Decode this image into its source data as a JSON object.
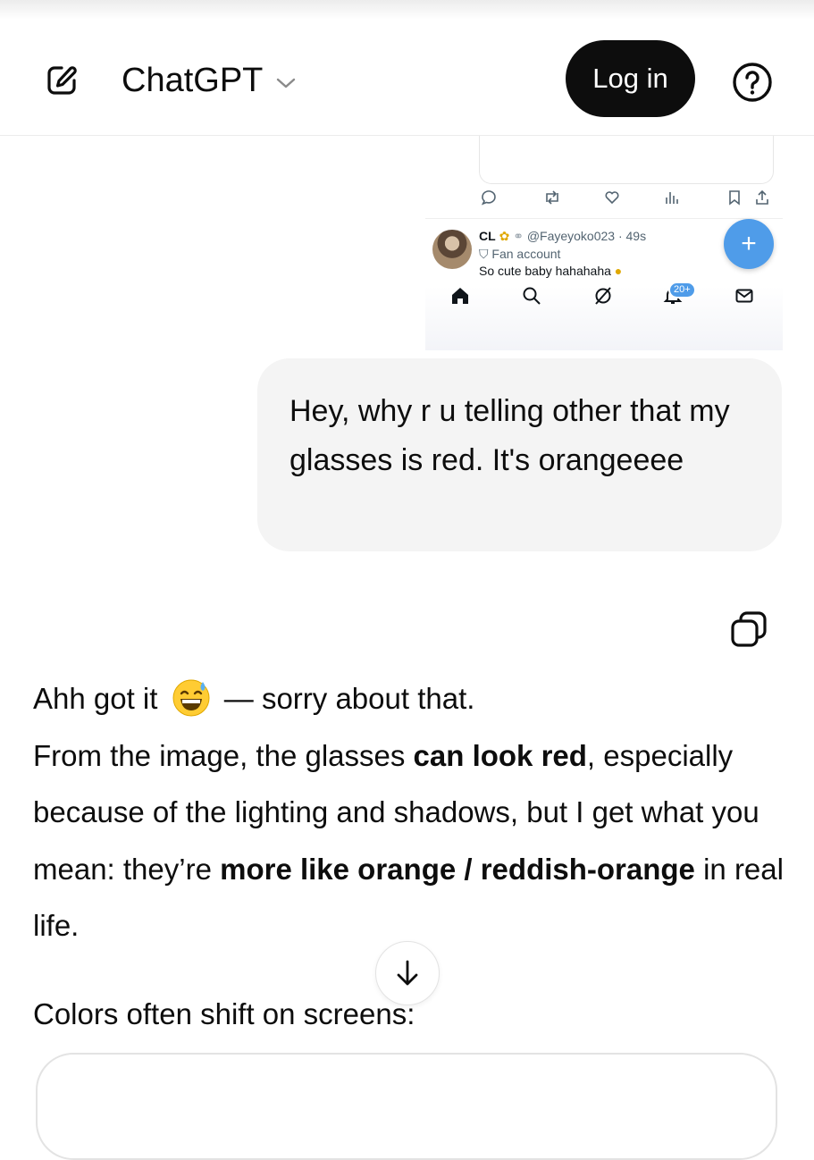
{
  "header": {
    "title": "ChatGPT",
    "login_label": "Log in",
    "icons": {
      "new_chat": "compose-icon",
      "model_menu": "chevron-down-icon",
      "help": "question-mark-icon"
    }
  },
  "embedded_screenshot": {
    "display_name": "CL",
    "handle_time": "@Fayeyoko023 · 49s",
    "label": "Fan account",
    "text": "So cute baby hahahaha",
    "badge": "20+",
    "fab": "+",
    "accent": "#4f9ce9"
  },
  "user_message": "Hey, why r u telling other that my glasses is red. It's orangeeee",
  "assistant": {
    "line1_a": "Ahh got it",
    "line1_b": "— sorry about that.",
    "p2_a": "From the image, the glasses ",
    "p2_b": "can look red",
    "p2_c": ", especially because of the lighting and shadows, but I get what you mean: they’re ",
    "p2_d": "more like orange / reddish-orange",
    "p2_e": " in real life.",
    "p3": "Colors often shift on screens:"
  },
  "colors": {
    "login_bg": "#0d0d0d",
    "user_bubble_bg": "#f4f4f4"
  }
}
